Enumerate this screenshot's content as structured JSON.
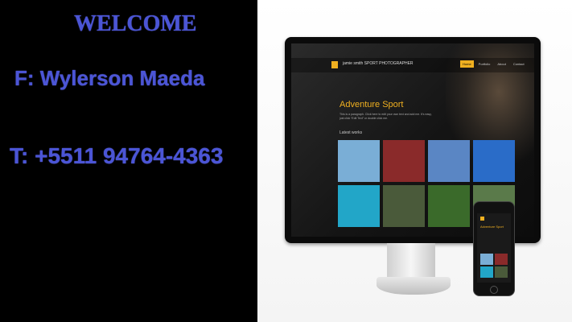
{
  "contact": {
    "welcome": "WELCOME",
    "name_line": "F: Wylerson Maeda",
    "phone_line": "T: +5511 94764-4363"
  },
  "mockup": {
    "site_brand": "jamie smith SPORT PHOTOGRAPHER",
    "nav": [
      "Home",
      "Portfolio",
      "About",
      "Contact"
    ],
    "hero_title": "Adventure Sport",
    "hero_text": "This is a paragraph. Click here to edit your own text and add me. It's easy, just click “Edit Text” or double click me.",
    "latest_label": "Latest works",
    "phone_title": "Adventure Sport",
    "thumb_colors": [
      "#7aaed6",
      "#8a2a2a",
      "#5a86c4",
      "#2a6cc8",
      "#22a6c8",
      "#4a5a3a",
      "#3a6a2a",
      "#5a7a4a"
    ],
    "phone_thumb_colors": [
      "#7aaed6",
      "#8a2a2a",
      "#22a6c8",
      "#4a5a3a"
    ]
  },
  "colors": {
    "text_accent": "#4b55d6",
    "site_accent": "#f0b020"
  }
}
